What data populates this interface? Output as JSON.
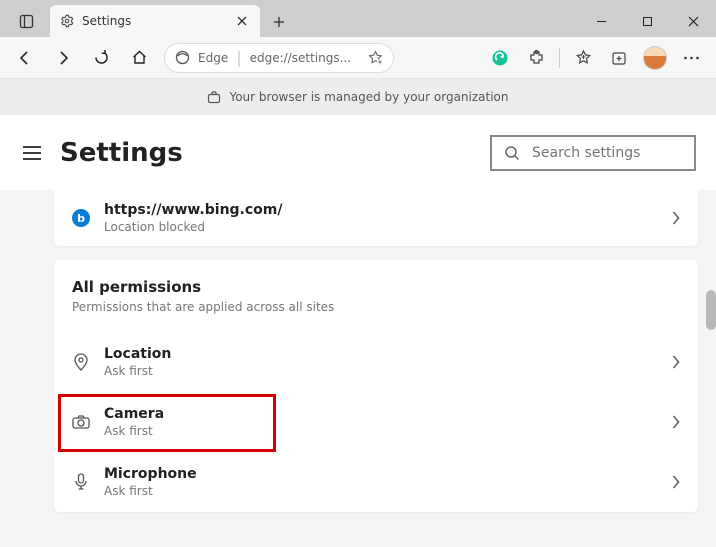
{
  "tab": {
    "title": "Settings"
  },
  "address": {
    "engine": "Edge",
    "url": "edge://settings..."
  },
  "banner": {
    "text": "Your browser is managed by your organization"
  },
  "header": {
    "title": "Settings"
  },
  "search": {
    "placeholder": "Search settings"
  },
  "recent": {
    "url": "https://www.bing.com/",
    "status": "Location blocked"
  },
  "allPerms": {
    "title": "All permissions",
    "subtitle": "Permissions that are applied across all sites"
  },
  "perm": {
    "location": {
      "title": "Location",
      "sub": "Ask first"
    },
    "camera": {
      "title": "Camera",
      "sub": "Ask first"
    },
    "microphone": {
      "title": "Microphone",
      "sub": "Ask first"
    }
  }
}
